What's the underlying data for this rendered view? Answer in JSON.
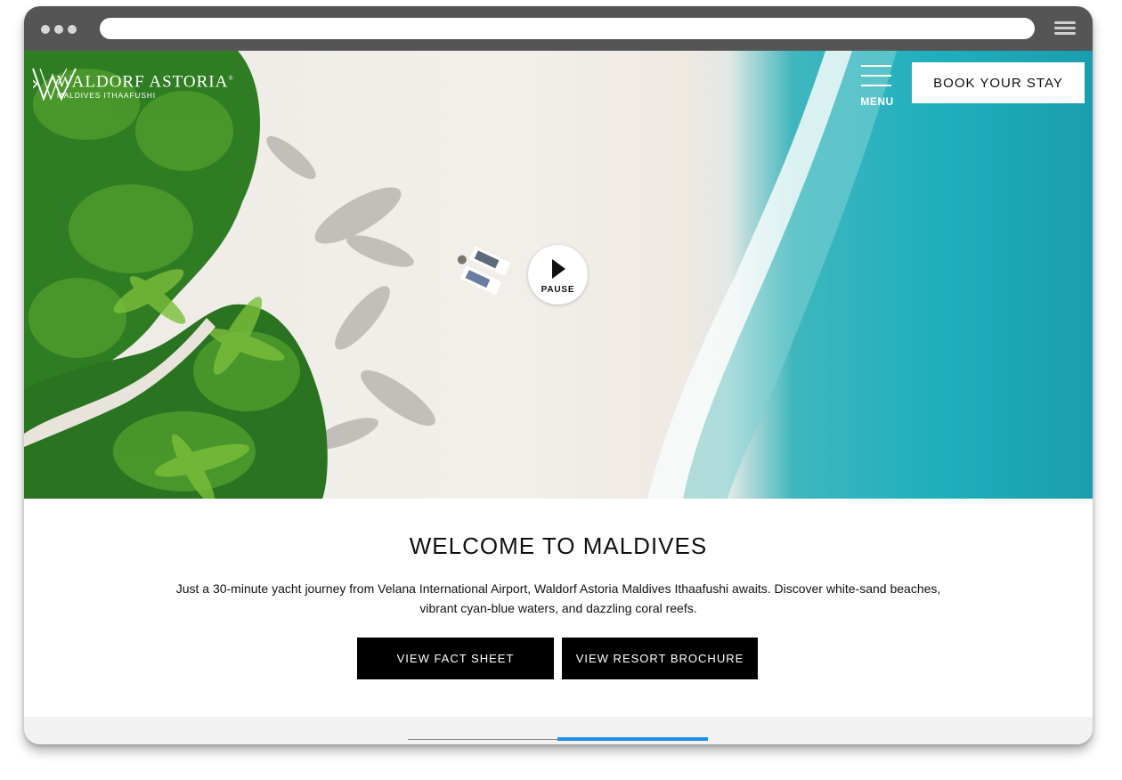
{
  "brand": {
    "name": "WALDORF ASTORIA",
    "registered": "®",
    "location": "MALDIVES ITHAAFUSHI"
  },
  "header": {
    "menu_label": "MENU",
    "book_label": "BOOK YOUR STAY"
  },
  "hero": {
    "video_control_label": "PAUSE"
  },
  "welcome": {
    "title": "WELCOME TO MALDIVES",
    "description_line1": "Just a 30-minute yacht journey from Velana International Airport, Waldorf Astoria Maldives Ithaafushi awaits. Discover white-sand beaches,",
    "description_line2": "vibrant cyan-blue waters, and dazzling coral reefs.",
    "buttons": [
      {
        "label": "VIEW FACT SHEET"
      },
      {
        "label": "VIEW RESORT BROCHURE"
      }
    ]
  },
  "carousel": {
    "progress_percent": 50
  },
  "colors": {
    "browser_chrome": "#555555",
    "cta_background": "#000000",
    "progress_accent": "#1e8fe6",
    "ocean": "#1fb0bd",
    "sand": "#f0ede8",
    "foliage": "#2f7d22"
  }
}
